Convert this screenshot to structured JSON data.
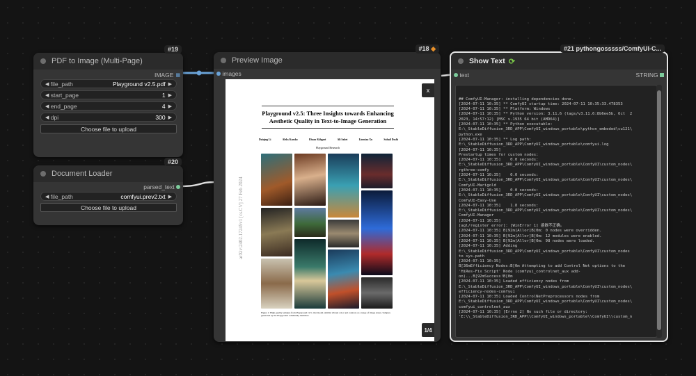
{
  "pdf_node": {
    "badge": "#19",
    "title": "PDF to Image (Multi-Page)",
    "output_label": "IMAGE",
    "widgets": [
      {
        "label": "file_path",
        "value": "Playground v2.5.pdf"
      },
      {
        "label": "start_page",
        "value": "1"
      },
      {
        "label": "end_page",
        "value": "4"
      },
      {
        "label": "dpi",
        "value": "300"
      }
    ],
    "upload_label": "Choose file to upload"
  },
  "doc_node": {
    "badge": "#20",
    "title": "Document Loader",
    "output_label": "parsed_text",
    "widget": {
      "label": "file_path",
      "value": "comfyui.prev2.txt"
    },
    "upload_label": "Choose file to upload"
  },
  "preview_node": {
    "badge": "#18",
    "title": "Preview Image",
    "input_label": "images",
    "close_label": "x",
    "page_counter": "1/4",
    "paper": {
      "title": "Playground v2.5: Three Insights towards Enhancing Aesthetic Quality in Text-to-Image Generation",
      "authors": [
        "Daiqing Li",
        "Aleks Kamko",
        "Ehsan Akhgari",
        "Ali Sabet",
        "Linmiao Xu",
        "Suhail Doshi"
      ],
      "affiliation": "Playground Research",
      "arxiv": "arXiv:2402.17245v1  [cs.CV]  27 Feb 2024",
      "caption": "Figure 1: High-quality samples from Playground v2.5. Our model exhibits vibrant color and contrast on a range of image styles. Samples generated by the Playground community members."
    }
  },
  "show_node": {
    "badge": "#21 pythongosssss/ComfyUI-C...",
    "title": "Show Text",
    "input_label": "text",
    "output_label": "STRING",
    "lines": [
      "## ComfyUI-Manager: installing dependencies done.",
      "[2024-07-11 10:35] ** ComfyUI startup time: 2024-07-11 10:35:33.478353",
      "[2024-07-11 10:35] ** Platform: Windows",
      "[2024-07-11 10:35] ** Python version: 3.11.6 (tags/v3.11.6:8b6ee5b, Oct  2",
      "2023, 14:57:12) [MSC v.1935 64 bit (AMD64)]",
      "[2024-07-11 10:35] ** Python executable:",
      "E:\\_StableDiffusion_3RD_APP\\ComfyUI_windows_portable\\python_embeded\\cu121\\",
      "python.exe",
      "[2024-07-11 10:35] ** Log path:",
      "E:\\_StableDiffusion_3RD_APP\\ComfyUI_windows_portable\\comfyui.log",
      "[2024-07-11 10:35]",
      "Prestartup times for custom nodes:",
      "[2024-07-11 10:35]    0.0 seconds:",
      "E:\\_StableDiffusion_3RD_APP\\ComfyUI_windows_portable\\ComfyUI\\custom_nodes\\",
      "rgthree-comfy",
      "[2024-07-11 10:35]    0.0 seconds:",
      "E:\\_StableDiffusion_3RD_APP\\ComfyUI_windows_portable\\ComfyUI\\custom_nodes\\",
      "ComfyUI-Marigold",
      "[2024-07-11 10:35]    0.0 seconds:",
      "E:\\_StableDiffusion_3RD_APP\\ComfyUI_windows_portable\\ComfyUI\\custom_nodes\\",
      "ComfyUI-Easy-Use",
      "[2024-07-11 10:35]    1.8 seconds:",
      "E:\\_StableDiffusion_3RD_APP\\ComfyUI_windows_portable\\ComfyUI\\custom_nodes\\",
      "ComfyUI-Manager",
      "[2024-07-11 10:35]",
      "[agl/register error]: [WinError 1] 函数不正确。",
      "[2024-07-11 10:35] B[92m[Allor]B[0m: 0 nodes were overridden.",
      "[2024-07-11 10:35] B[92m[Allor]B[0m: 12 modules were enabled.",
      "[2024-07-11 10:35] B[92m[Allor]B[0m: 98 nodes were loaded.",
      "[2024-07-11 10:35] Adding",
      "E:\\_StableDiffusion_3RD_APP\\ComfyUI_windows_portable\\ComfyUI\\custom_nodes",
      "to sys.path",
      "[2024-07-11 10:35]",
      "B[36mEfficiency Nodes:B[0m Attempting to add Control Net options to the",
      "'HiRes-Fix Script' Node (comfyui_controlnet_aux add-",
      "on)...B[92mSuccess!B[0m",
      "[2024-07-11 10:35] Loaded efficiency nodes from",
      "E:\\_StableDiffusion_3RD_APP\\ComfyUI_windows_portable\\ComfyUI\\custom_nodes\\",
      "efficiency-nodes-comfyui",
      "[2024-07-11 10:35] Loaded ControlNetPreprocessors nodes from",
      "E:\\_StableDiffusion_3RD_APP\\ComfyUI_windows_portable\\ComfyUI\\custom_nodes\\",
      "comfyui_controlnet_aux",
      "[2024-07-11 10:35] [Errno 2] No such file or directory:",
      "'E:\\\\_StableDiffusion_3RD_APP\\\\ComfyUI_windows_portable\\\\ComfyUI\\\\custom_n"
    ]
  },
  "colors": {
    "image_link": "#6aa3d8",
    "string_link": "#7dcc9c",
    "text_link": "#dddddd"
  }
}
